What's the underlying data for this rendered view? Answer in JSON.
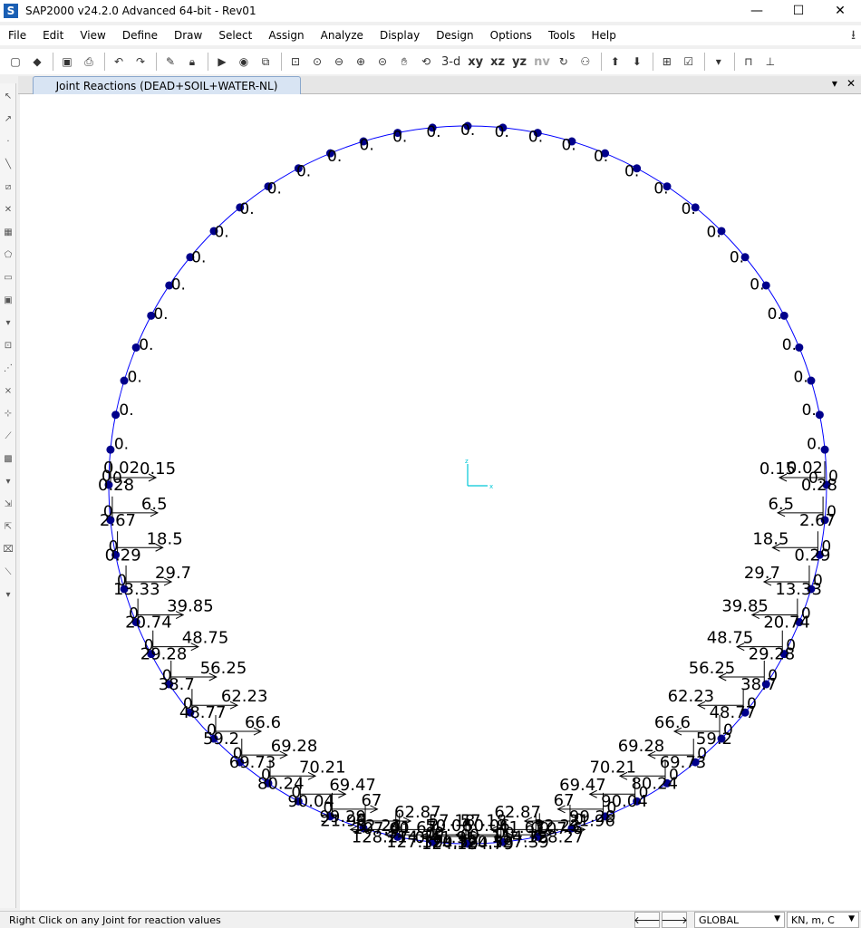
{
  "window": {
    "title": "SAP2000 v24.2.0 Advanced 64-bit - Rev01",
    "app_icon_letter": "S",
    "minimize": "—",
    "maximize": "☐",
    "close": "✕"
  },
  "menu": [
    "File",
    "Edit",
    "View",
    "Define",
    "Draw",
    "Select",
    "Assign",
    "Analyze",
    "Display",
    "Design",
    "Options",
    "Tools",
    "Help"
  ],
  "toolbar": {
    "view_3d": "3-d",
    "view_xy": "xy",
    "view_xz": "xz",
    "view_yz": "yz",
    "view_nv": "nv"
  },
  "tab": {
    "label": "Joint Reactions   (DEAD+SOIL+WATER-NL)",
    "dropdown": "▾",
    "close": "✕"
  },
  "diagram": {
    "ring_color": "#0000ff",
    "joint_color": "#00008b",
    "arrow_color": "#000000",
    "axis_color": "#00c8d8",
    "axis_x_label": "x",
    "axis_z_label": "z",
    "joint_count": 64,
    "upper_labels": "0.",
    "left_values": [
      {
        "h": "0.15",
        "v": "0.28"
      },
      {
        "h": "6.5",
        "v": "2.67"
      },
      {
        "h": "18.5",
        "v": "0.29"
      },
      {
        "h": "29.7",
        "v": "13.33"
      },
      {
        "h": "39.85",
        "v": "20.74"
      },
      {
        "h": "48.75",
        "v": "29.28"
      },
      {
        "h": "56.25",
        "v": "38.7"
      },
      {
        "h": "62.23",
        "v": "48.77"
      },
      {
        "h": "66.6",
        "v": "59.2"
      },
      {
        "h": "69.28",
        "v": "69.73"
      },
      {
        "h": "70.21",
        "v": "80.24"
      },
      {
        "h": "69.47",
        "v": "90.04"
      },
      {
        "h": "67",
        "v": "99.29"
      },
      {
        "h": "62.87",
        "v": "107.6"
      },
      {
        "h": "57.18",
        "v": "114.75"
      },
      {
        "h": "50.06",
        "v": "120.53"
      },
      {
        "h": "41.67",
        "v": "124.79"
      },
      {
        "h": "32.23",
        "v": "127.39"
      },
      {
        "h": "21.96",
        "v": "128.27"
      }
    ],
    "extra_left": "0.02",
    "extra_right": "0.02",
    "bottom_text": "0.41.96"
  },
  "status": {
    "hint": "Right Click on any Joint for reaction values",
    "prev": "🡐",
    "next": "🡒",
    "coord_system": "GLOBAL",
    "units": "KN, m, C"
  }
}
